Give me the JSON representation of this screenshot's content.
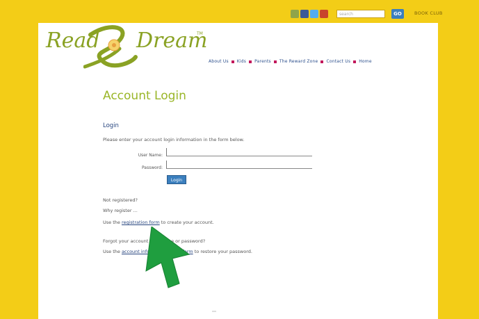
{
  "header": {
    "search_placeholder": "search",
    "go_label": "GO",
    "book_club_label": "BOOK CLUB",
    "social_icons": [
      "email-icon",
      "facebook-icon",
      "twitter-icon",
      "myspace-icon"
    ]
  },
  "logo": {
    "part1": "Read",
    "part2": "Dream",
    "tm": "TM"
  },
  "nav": {
    "items": [
      "About Us",
      "Kids",
      "Parents",
      "The Reward Zone",
      "Contact Us",
      "Home"
    ]
  },
  "main": {
    "title": "Account Login",
    "login_heading": "Login",
    "intro": "Please enter your account login information in the form below.",
    "username_label": "User Name:",
    "password_label": "Password:",
    "login_button": "Login",
    "not_registered": "Not registered?",
    "why_register": "Why register ...",
    "register_prefix": "Use the ",
    "register_link": "registration form",
    "register_suffix": " to create your account.",
    "forgot_heading": "Forgot your account user name or password?",
    "forgot_prefix": "Use the ",
    "forgot_link": "account information email form",
    "forgot_suffix": " to restore your password."
  },
  "colors": {
    "background": "#f3cd17",
    "logo_green": "#8aa224",
    "title_green": "#9ab628",
    "link_blue": "#27457f",
    "accent_pink": "#c2185b",
    "button_blue": "#3b7fbe",
    "arrow_green": "#1f9e3f"
  }
}
